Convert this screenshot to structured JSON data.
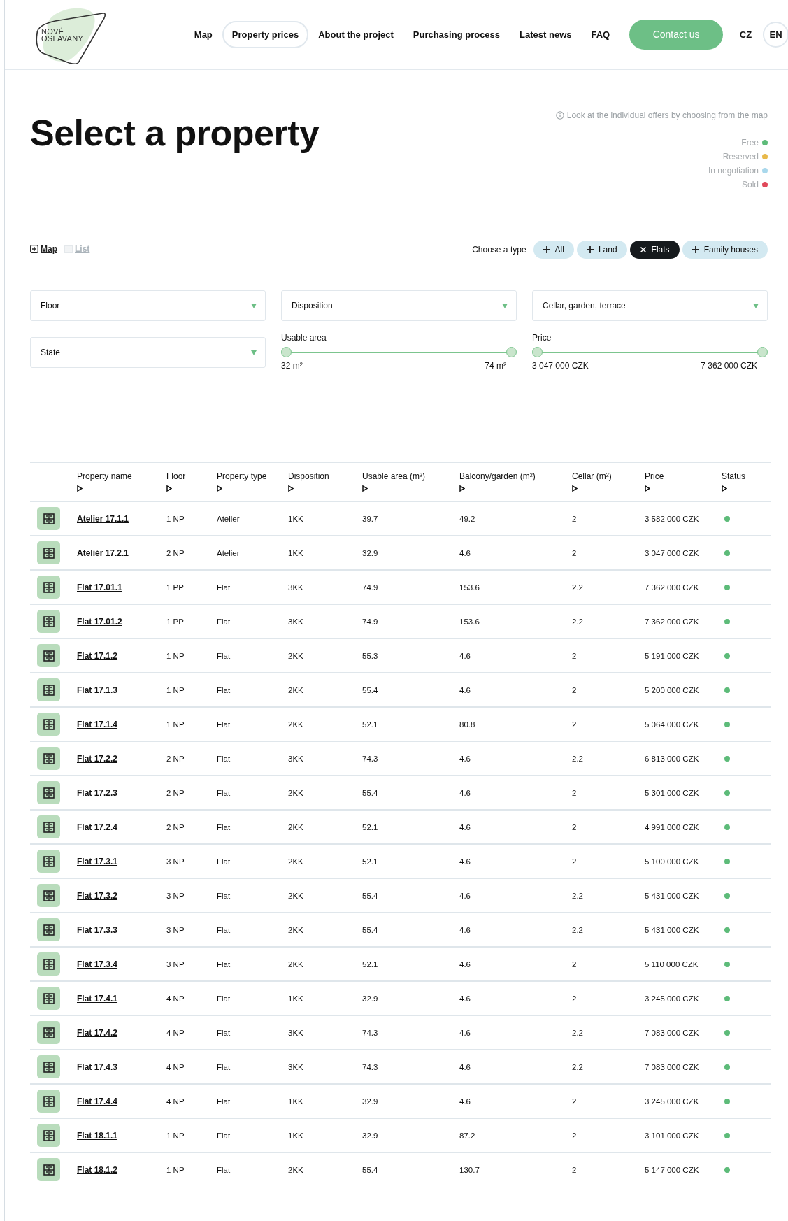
{
  "logo": {
    "line_1": "NOVÉ",
    "line_2": "OSLAVANY"
  },
  "nav": [
    {
      "label": "Map",
      "selected": false
    },
    {
      "label": "Property prices",
      "selected": true
    },
    {
      "label": "About the project",
      "selected": false
    },
    {
      "label": "Purchasing process",
      "selected": false
    },
    {
      "label": "Latest news",
      "selected": false
    },
    {
      "label": "FAQ",
      "selected": false
    }
  ],
  "contact_button": "Contact us",
  "languages": [
    {
      "label": "CZ",
      "selected": false
    },
    {
      "label": "EN",
      "selected": true
    }
  ],
  "title": "Select a property",
  "map_hint": "Look at the individual offers by choosing from the map",
  "legend": [
    {
      "label": "Free",
      "color": "#5dbb79"
    },
    {
      "label": "Reserved",
      "color": "#e8b94a"
    },
    {
      "label": "In negotiation",
      "color": "#a9d8ec"
    },
    {
      "label": "Sold",
      "color": "#e0485a"
    }
  ],
  "views": [
    {
      "label": "Map",
      "selected": true
    },
    {
      "label": "List",
      "selected": false
    }
  ],
  "type_label": "Choose a type",
  "types": [
    {
      "label": "All",
      "selected": false
    },
    {
      "label": "Land",
      "selected": false
    },
    {
      "label": "Flats",
      "selected": true
    },
    {
      "label": "Family houses",
      "selected": false
    }
  ],
  "dropdowns": [
    {
      "label": "Floor"
    },
    {
      "label": "Disposition"
    },
    {
      "label": "Cellar, garden, terrace"
    },
    {
      "label": "State"
    }
  ],
  "sliders": [
    {
      "label": "Usable area",
      "min": "32 m²",
      "max": "74 m²",
      "level": 1
    },
    {
      "label": "Price",
      "min": "3 047 000 CZK",
      "max": "7 362 000 CZK",
      "level": 1
    }
  ],
  "table": {
    "columns": [
      "Property name",
      "Floor",
      "Property type",
      "Disposition",
      "Usable area (m²)",
      "Balcony/garden (m²)",
      "Cellar (m²)",
      "Price",
      "Status"
    ],
    "rows": [
      {
        "name": "Atelier 17.1.1",
        "floor": "1 NP",
        "type": "Atelier",
        "disposition": "1KK",
        "usable": "39.7",
        "balcony": "49.2",
        "cellar": "2",
        "price": "3 582 000 CZK",
        "color": "#5dbb79"
      },
      {
        "name": "Ateliér 17.2.1",
        "floor": "2 NP",
        "type": "Atelier",
        "disposition": "1KK",
        "usable": "32.9",
        "balcony": "4.6",
        "cellar": "2",
        "price": "3 047 000 CZK",
        "color": "#5dbb79"
      },
      {
        "name": "Flat 17.01.1",
        "floor": "1 PP",
        "type": "Flat",
        "disposition": "3KK",
        "usable": "74.9",
        "balcony": "153.6",
        "cellar": "2.2",
        "price": "7 362 000 CZK",
        "color": "#5dbb79"
      },
      {
        "name": "Flat 17.01.2",
        "floor": "1 PP",
        "type": "Flat",
        "disposition": "3KK",
        "usable": "74.9",
        "balcony": "153.6",
        "cellar": "2.2",
        "price": "7 362 000 CZK",
        "color": "#5dbb79"
      },
      {
        "name": "Flat 17.1.2",
        "floor": "1 NP",
        "type": "Flat",
        "disposition": "2KK",
        "usable": "55.3",
        "balcony": "4.6",
        "cellar": "2",
        "price": "5 191 000 CZK",
        "color": "#5dbb79"
      },
      {
        "name": "Flat 17.1.3",
        "floor": "1 NP",
        "type": "Flat",
        "disposition": "2KK",
        "usable": "55.4",
        "balcony": "4.6",
        "cellar": "2",
        "price": "5 200 000 CZK",
        "color": "#5dbb79"
      },
      {
        "name": "Flat 17.1.4",
        "floor": "1 NP",
        "type": "Flat",
        "disposition": "2KK",
        "usable": "52.1",
        "balcony": "80.8",
        "cellar": "2",
        "price": "5 064 000 CZK",
        "color": "#5dbb79"
      },
      {
        "name": "Flat 17.2.2",
        "floor": "2 NP",
        "type": "Flat",
        "disposition": "3KK",
        "usable": "74.3",
        "balcony": "4.6",
        "cellar": "2.2",
        "price": "6 813 000 CZK",
        "color": "#5dbb79"
      },
      {
        "name": "Flat 17.2.3",
        "floor": "2 NP",
        "type": "Flat",
        "disposition": "2KK",
        "usable": "55.4",
        "balcony": "4.6",
        "cellar": "2",
        "price": "5 301 000 CZK",
        "color": "#5dbb79"
      },
      {
        "name": "Flat 17.2.4",
        "floor": "2 NP",
        "type": "Flat",
        "disposition": "2KK",
        "usable": "52.1",
        "balcony": "4.6",
        "cellar": "2",
        "price": "4 991 000 CZK",
        "color": "#5dbb79"
      },
      {
        "name": "Flat 17.3.1",
        "floor": "3 NP",
        "type": "Flat",
        "disposition": "2KK",
        "usable": "52.1",
        "balcony": "4.6",
        "cellar": "2",
        "price": "5 100 000 CZK",
        "color": "#5dbb79"
      },
      {
        "name": "Flat 17.3.2",
        "floor": "3 NP",
        "type": "Flat",
        "disposition": "2KK",
        "usable": "55.4",
        "balcony": "4.6",
        "cellar": "2.2",
        "price": "5 431 000 CZK",
        "color": "#5dbb79"
      },
      {
        "name": "Flat 17.3.3",
        "floor": "3 NP",
        "type": "Flat",
        "disposition": "2KK",
        "usable": "55.4",
        "balcony": "4.6",
        "cellar": "2.2",
        "price": "5 431 000 CZK",
        "color": "#5dbb79"
      },
      {
        "name": "Flat 17.3.4",
        "floor": "3 NP",
        "type": "Flat",
        "disposition": "2KK",
        "usable": "52.1",
        "balcony": "4.6",
        "cellar": "2",
        "price": "5 110 000 CZK",
        "color": "#5dbb79"
      },
      {
        "name": "Flat 17.4.1",
        "floor": "4 NP",
        "type": "Flat",
        "disposition": "1KK",
        "usable": "32.9",
        "balcony": "4.6",
        "cellar": "2",
        "price": "3 245 000 CZK",
        "color": "#5dbb79"
      },
      {
        "name": "Flat 17.4.2",
        "floor": "4 NP",
        "type": "Flat",
        "disposition": "3KK",
        "usable": "74.3",
        "balcony": "4.6",
        "cellar": "2.2",
        "price": "7 083 000 CZK",
        "color": "#5dbb79"
      },
      {
        "name": "Flat 17.4.3",
        "floor": "4 NP",
        "type": "Flat",
        "disposition": "3KK",
        "usable": "74.3",
        "balcony": "4.6",
        "cellar": "2.2",
        "price": "7 083 000 CZK",
        "color": "#5dbb79"
      },
      {
        "name": "Flat 17.4.4",
        "floor": "4 NP",
        "type": "Flat",
        "disposition": "1KK",
        "usable": "32.9",
        "balcony": "4.6",
        "cellar": "2",
        "price": "3 245 000 CZK",
        "color": "#5dbb79"
      },
      {
        "name": "Flat 18.1.1",
        "floor": "1 NP",
        "type": "Flat",
        "disposition": "1KK",
        "usable": "32.9",
        "balcony": "87.2",
        "cellar": "2",
        "price": "3 101 000 CZK",
        "color": "#5dbb79"
      },
      {
        "name": "Flat 18.1.2",
        "floor": "1 NP",
        "type": "Flat",
        "disposition": "2KK",
        "usable": "55.4",
        "balcony": "130.7",
        "cellar": "2",
        "price": "5 147 000 CZK",
        "color": "#5dbb79"
      }
    ]
  }
}
